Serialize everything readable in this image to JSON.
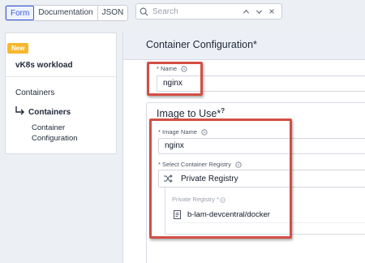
{
  "top_tabs": [
    {
      "label": "Form",
      "active": true
    },
    {
      "label": "Documentation",
      "active": false
    },
    {
      "label": "JSON",
      "active": false
    }
  ],
  "search": {
    "placeholder": "Search"
  },
  "sidebar": {
    "badge": "New",
    "workload_title": "vK8s workload",
    "items": [
      {
        "label": "Containers"
      },
      {
        "label": "Containers",
        "active": true
      },
      {
        "label": "Container Configuration"
      }
    ]
  },
  "main": {
    "title": "Container Configuration",
    "title_req": "*",
    "name": {
      "label": "* Name",
      "value": "nginx"
    },
    "image_section": {
      "title": "Image to Use",
      "title_req": "*",
      "image_name": {
        "label": "* Image Name",
        "value": "nginx"
      },
      "registry_select": {
        "label": "* Select Container Registry",
        "value": "Private Registry"
      },
      "private_registry": {
        "label": "Private Registry *",
        "value": "b-lam-devcentral/docker"
      }
    }
  },
  "colors": {
    "accent": "#3b5bdb",
    "badge": "#f5b82e",
    "highlight": "#d24f45"
  }
}
